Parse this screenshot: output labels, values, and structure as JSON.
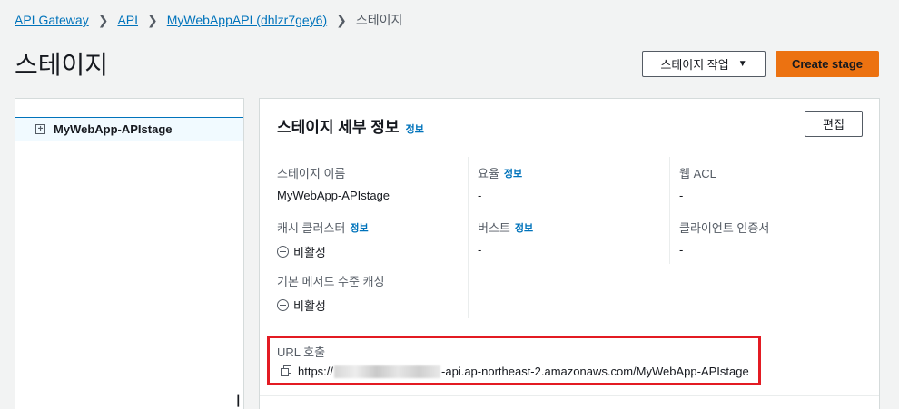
{
  "breadcrumb": {
    "items": [
      "API Gateway",
      "API",
      "MyWebAppAPI (dhlzr7gey6)"
    ],
    "current": "스테이지"
  },
  "page": {
    "title": "스테이지",
    "stage_actions_label": "스테이지 작업",
    "create_stage_label": "Create stage"
  },
  "sidebar": {
    "stage_name": "MyWebApp-APIstage"
  },
  "details": {
    "title": "스테이지 세부 정보",
    "info": "정보",
    "edit_label": "편집",
    "stage_name_label": "스테이지 이름",
    "stage_name_value": "MyWebApp-APIstage",
    "cache_cluster_label": "캐시 클러스터",
    "cache_cluster_value": "비활성",
    "default_cache_label": "기본 메서드 수준 캐싱",
    "default_cache_value": "비활성",
    "rate_label": "요율",
    "rate_value": "-",
    "burst_label": "버스트",
    "burst_value": "-",
    "waf_label": "웹 ACL",
    "waf_value": "-",
    "client_cert_label": "클라이언트 인증서",
    "client_cert_value": "-",
    "invoke_url_label": "URL 호출",
    "invoke_url_prefix": "https://",
    "invoke_url_suffix": "-api.ap-northeast-2.amazonaws.com/MyWebApp-APIstage"
  },
  "colors": {
    "link": "#0073bb",
    "primary": "#ec7211",
    "highlight": "#e31b23"
  }
}
